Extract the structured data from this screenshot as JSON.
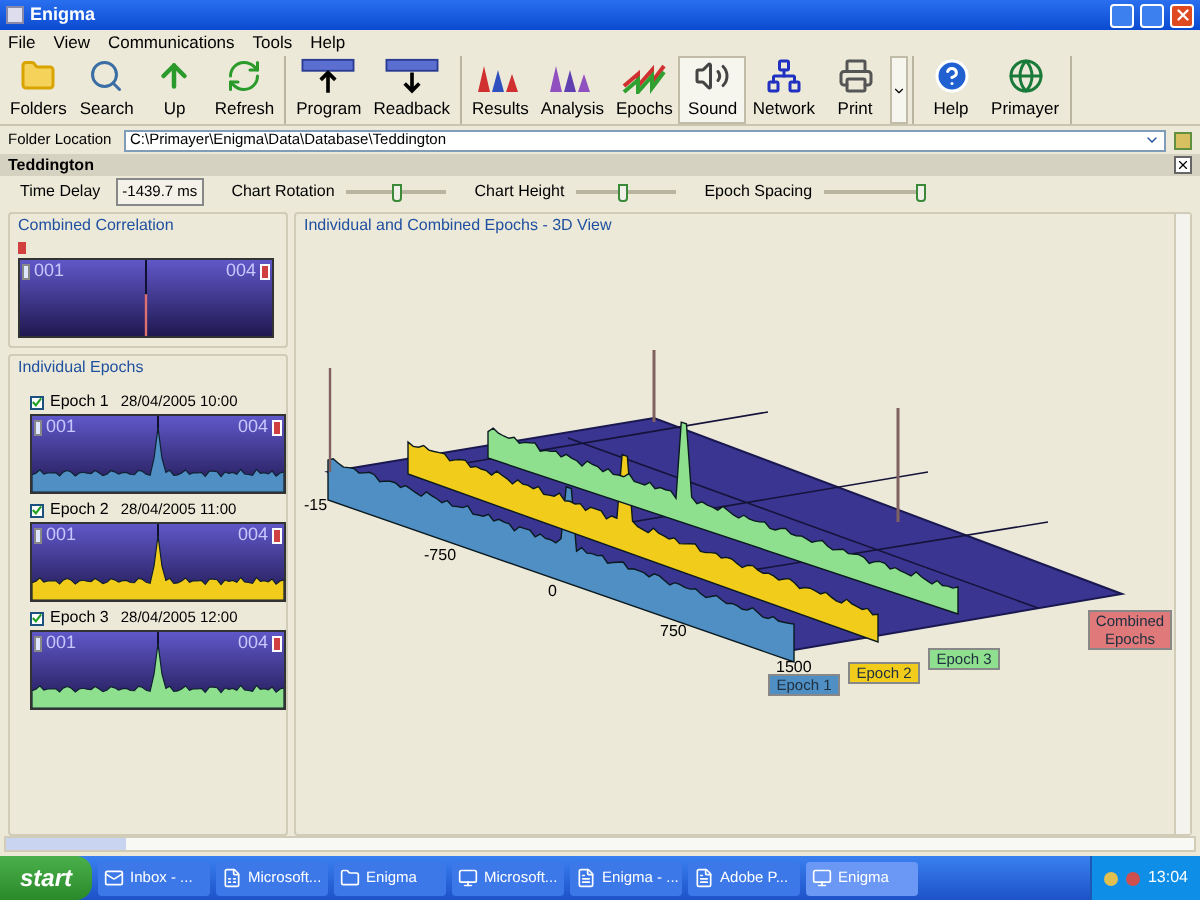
{
  "window": {
    "title": "Enigma"
  },
  "menu": [
    "File",
    "View",
    "Communications",
    "Tools",
    "Help"
  ],
  "toolbar": [
    [
      {
        "label": "Folders",
        "kind": "folders",
        "pressed": false
      },
      {
        "label": "Search",
        "kind": "search",
        "pressed": false
      },
      {
        "label": "Up",
        "kind": "up",
        "pressed": false
      },
      {
        "label": "Refresh",
        "kind": "refresh",
        "pressed": false
      }
    ],
    [
      {
        "label": "Program",
        "kind": "program",
        "pressed": false
      },
      {
        "label": "Readback",
        "kind": "readback",
        "pressed": false
      }
    ],
    [
      {
        "label": "Results",
        "kind": "results",
        "pressed": false
      },
      {
        "label": "Analysis",
        "kind": "analysis",
        "pressed": false
      },
      {
        "label": "Epochs",
        "kind": "epochs",
        "pressed": false
      },
      {
        "label": "Sound",
        "kind": "sound",
        "pressed": true
      },
      {
        "label": "Network",
        "kind": "network",
        "pressed": false
      },
      {
        "label": "Print",
        "kind": "print",
        "pressed": false
      }
    ],
    [
      {
        "label": "Help",
        "kind": "help",
        "pressed": false
      },
      {
        "label": "Primayer",
        "kind": "globe",
        "pressed": false
      }
    ]
  ],
  "folder_location": {
    "label": "Folder Location",
    "value": "C:\\Primayer\\Enigma\\Data\\Database\\Teddington"
  },
  "site_header": {
    "title": "Teddington"
  },
  "controls": {
    "time_delay": {
      "label": "Time Delay",
      "value": "-1439.7 ms"
    },
    "sliders": [
      {
        "label": "Chart Rotation",
        "level": 0.5
      },
      {
        "label": "Chart Height",
        "level": 0.45
      },
      {
        "label": "Epoch Spacing",
        "level": 0.95
      }
    ]
  },
  "combined_correlation": {
    "title": "Combined Correlation",
    "start_label": "001",
    "end_label": "004"
  },
  "individual_epochs": {
    "title": "Individual Epochs",
    "items": [
      {
        "name": "Epoch 1",
        "timestamp": "28/04/2005 10:00",
        "checked": true,
        "start_label": "001",
        "end_label": "004",
        "color": "#4f8fc4"
      },
      {
        "name": "Epoch 2",
        "timestamp": "28/04/2005 11:00",
        "checked": true,
        "start_label": "001",
        "end_label": "004",
        "color": "#f2cc1a"
      },
      {
        "name": "Epoch 3",
        "timestamp": "28/04/2005 12:00",
        "checked": true,
        "start_label": "001",
        "end_label": "004",
        "color": "#8ee08e"
      }
    ]
  },
  "view_3d": {
    "title": "Individual and Combined Epochs - 3D View",
    "axis_labels": [
      "-15",
      "-750",
      "0",
      "750",
      "1500"
    ],
    "series_labels": [
      {
        "label": "Epoch 1",
        "color": "#4f8fc4"
      },
      {
        "label": "Epoch 2",
        "color": "#f2cc1a"
      },
      {
        "label": "Epoch 3",
        "color": "#8ee08e"
      },
      {
        "label": "Combined Epochs",
        "color": "#e07a7a"
      }
    ]
  },
  "taskbar": {
    "start": "start",
    "items": [
      {
        "label": "Inbox - ...",
        "selected": false
      },
      {
        "label": "Microsoft...",
        "selected": false
      },
      {
        "label": "Enigma",
        "selected": false
      },
      {
        "label": "Microsoft...",
        "selected": false
      },
      {
        "label": "Enigma - ...",
        "selected": false
      },
      {
        "label": "Adobe P...",
        "selected": false
      },
      {
        "label": "Enigma",
        "selected": true
      }
    ],
    "clock": "13:04"
  }
}
